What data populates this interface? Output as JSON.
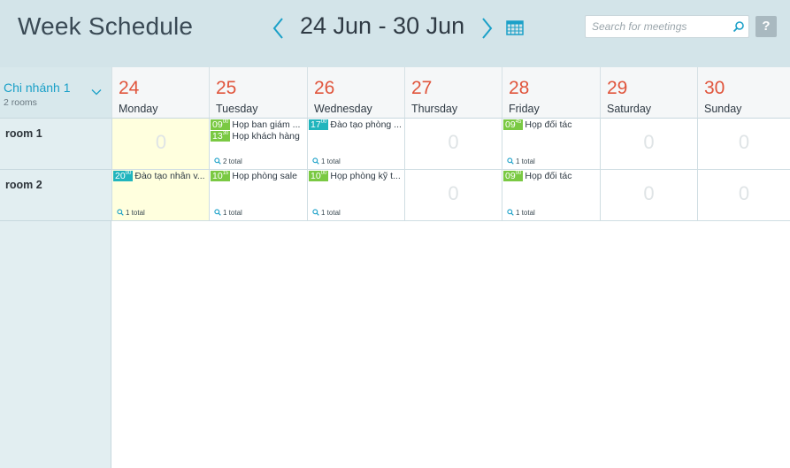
{
  "header": {
    "title": "Week Schedule",
    "date_range": "24 Jun - 30 Jun",
    "search_placeholder": "Search for meetings",
    "help_label": "?"
  },
  "sidebar": {
    "branch": {
      "name": "Chi nhánh 1",
      "subtitle": "2 rooms"
    },
    "rooms": [
      "room 1",
      "room 2"
    ]
  },
  "days": [
    {
      "num": "24",
      "name": "Monday"
    },
    {
      "num": "25",
      "name": "Tuesday"
    },
    {
      "num": "26",
      "name": "Wednesday"
    },
    {
      "num": "27",
      "name": "Thursday"
    },
    {
      "num": "28",
      "name": "Friday"
    },
    {
      "num": "29",
      "name": "Saturday"
    },
    {
      "num": "30",
      "name": "Sunday"
    }
  ],
  "grid": [
    [
      {
        "zero": "0"
      },
      {
        "meetings": [
          {
            "h": "09",
            "m": "00",
            "title": "Họp ban giám ..."
          },
          {
            "h": "13",
            "m": "30",
            "title": "Họp khách hàng"
          }
        ],
        "total": "2 total"
      },
      {
        "meetings": [
          {
            "h": "17",
            "m": "00",
            "title": "Đào tạo phòng ...",
            "teal": true
          }
        ],
        "total": "1 total"
      },
      {
        "zero": "0"
      },
      {
        "meetings": [
          {
            "h": "09",
            "m": "45",
            "title": "Họp đối tác"
          }
        ],
        "total": "1 total"
      },
      {
        "zero": "0"
      },
      {
        "zero": "0"
      }
    ],
    [
      {
        "meetings": [
          {
            "h": "20",
            "m": "00",
            "title": "Đào tạo nhân v...",
            "teal": true
          }
        ],
        "total": "1 total"
      },
      {
        "meetings": [
          {
            "h": "10",
            "m": "15",
            "title": "Họp phòng sale"
          }
        ],
        "total": "1 total"
      },
      {
        "meetings": [
          {
            "h": "10",
            "m": "00",
            "title": "Họp phòng kỹ t..."
          }
        ],
        "total": "1 total"
      },
      {
        "zero": "0"
      },
      {
        "meetings": [
          {
            "h": "09",
            "m": "00",
            "title": "Họp đối tác"
          }
        ],
        "total": "1 total"
      },
      {
        "zero": "0"
      },
      {
        "zero": "0"
      }
    ]
  ],
  "colors": {
    "accent": "#1aa0c8",
    "date": "#e0553c",
    "time_green": "#7ac943",
    "time_teal": "#21b5bd",
    "today": "#ffffde"
  },
  "icons": {
    "prev": "chevron-left-icon",
    "next": "chevron-right-icon",
    "calendar": "calendar-icon",
    "search": "search-icon",
    "branch_toggle": "chevron-down-icon",
    "total": "magnifier-icon"
  }
}
